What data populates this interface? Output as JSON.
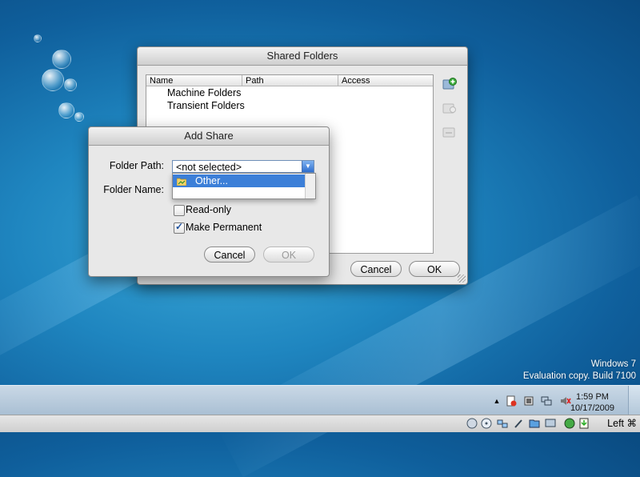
{
  "shared_folders": {
    "title": "Shared Folders",
    "columns": [
      "Name",
      "Path",
      "Access"
    ],
    "items": [
      "Machine Folders",
      "Transient Folders"
    ],
    "cancel_label": "Cancel",
    "ok_label": "OK"
  },
  "add_share": {
    "title": "Add Share",
    "folder_path_label": "Folder Path:",
    "folder_name_label": "Folder Name:",
    "folder_path_value": "<not selected>",
    "dropdown_option": "Other...",
    "readonly_label": "Read-only",
    "readonly_checked": false,
    "permanent_label": "Make Permanent",
    "permanent_checked": true,
    "cancel_label": "Cancel",
    "ok_label": "OK"
  },
  "watermark": {
    "line1": "Windows 7",
    "line2": "Evaluation copy. Build 7100"
  },
  "taskbar": {
    "time": "1:59 PM",
    "date": "10/17/2009"
  },
  "vbox_status": {
    "host_key": "Left ⌘"
  }
}
